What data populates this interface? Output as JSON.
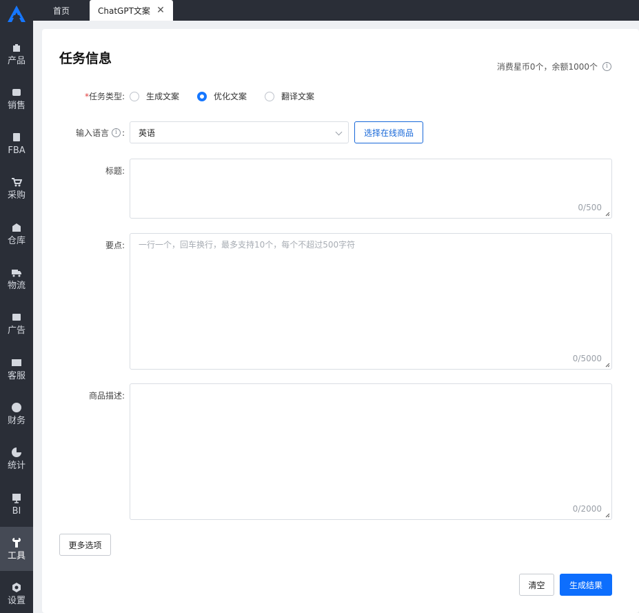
{
  "sidebar": {
    "items": [
      {
        "label": "产品",
        "icon": "bag-icon"
      },
      {
        "label": "销售",
        "icon": "sell-tag-icon"
      },
      {
        "label": "FBA",
        "icon": "amazon-box-icon"
      },
      {
        "label": "采购",
        "icon": "cart-icon"
      },
      {
        "label": "仓库",
        "icon": "warehouse-icon"
      },
      {
        "label": "物流",
        "icon": "truck-icon"
      },
      {
        "label": "广告",
        "icon": "ad-icon"
      },
      {
        "label": "客服",
        "icon": "mail-icon"
      },
      {
        "label": "财务",
        "icon": "yen-icon"
      },
      {
        "label": "统计",
        "icon": "pie-chart-icon"
      },
      {
        "label": "BI",
        "icon": "bi-chart-icon"
      },
      {
        "label": "工具",
        "icon": "wrench-icon",
        "active": true
      },
      {
        "label": "设置",
        "icon": "settings-icon"
      }
    ]
  },
  "tabs": {
    "home": "首页",
    "active": "ChatGPT文案",
    "close_glyph": "✕"
  },
  "page": {
    "title": "任务信息",
    "balance": "消费星币0个，余额1000个",
    "info_glyph": "i"
  },
  "form": {
    "task_type": {
      "required_mark": "*",
      "label": "任务类型:",
      "options": [
        "生成文案",
        "优化文案",
        "翻译文案"
      ],
      "selected": "优化文案"
    },
    "language": {
      "label": "输入语言",
      "colon": ":",
      "value": "英语",
      "select_product_button": "选择在线商品"
    },
    "title": {
      "label": "标题:",
      "counter": "0/500"
    },
    "points": {
      "label": "要点:",
      "placeholder": "一行一个，回车换行，最多支持10个，每个不超过500字符",
      "counter": "0/5000"
    },
    "description": {
      "label": "商品描述:",
      "counter": "0/2000"
    }
  },
  "actions": {
    "more_options": "更多选项",
    "clear": "清空",
    "generate": "生成结果"
  },
  "colors": {
    "sidebar_bg": "#2a2e37",
    "accent": "#0d6efd",
    "required": "#e23b3b"
  }
}
